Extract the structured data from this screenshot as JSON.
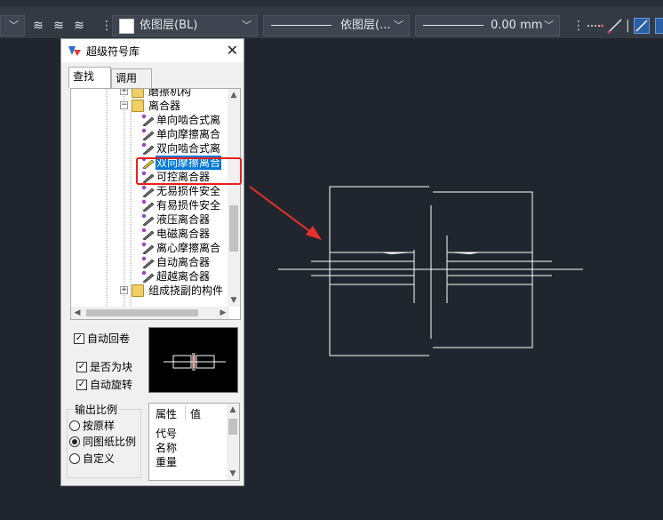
{
  "toolbar": {
    "layer_name": "依图层(BL)",
    "linetype_label": "依图层(...",
    "lineweight_label": "0.00 mm"
  },
  "dialog": {
    "title": "超级符号库",
    "close_glyph": "✕",
    "tabs": [
      {
        "label": "查找"
      },
      {
        "label": "调用"
      }
    ],
    "tree": [
      {
        "label": "磨擦机构",
        "kind": "folder",
        "expander": "+"
      },
      {
        "label": "离合器",
        "kind": "folder",
        "expander": "−"
      },
      {
        "label": "单向啮合式离",
        "kind": "item"
      },
      {
        "label": "单向摩擦离合",
        "kind": "item"
      },
      {
        "label": "双向啮合式离",
        "kind": "item"
      },
      {
        "label": "双向摩擦离合",
        "kind": "item",
        "selected": true
      },
      {
        "label": "可控离合器",
        "kind": "item"
      },
      {
        "label": "无易损件安全",
        "kind": "item"
      },
      {
        "label": "有易损件安全",
        "kind": "item"
      },
      {
        "label": "液压离合器",
        "kind": "item"
      },
      {
        "label": "电磁离合器",
        "kind": "item"
      },
      {
        "label": "离心摩擦离合",
        "kind": "item"
      },
      {
        "label": "自动离合器",
        "kind": "item"
      },
      {
        "label": "超越离合器",
        "kind": "item"
      },
      {
        "label": "组成挠副的构件",
        "kind": "folder",
        "expander": "+"
      }
    ],
    "auto_return": {
      "label": "自动回卷",
      "checked": true
    },
    "as_block": {
      "label": "是否为块",
      "checked": true
    },
    "auto_rotate": {
      "label": "自动旋转",
      "checked": true
    },
    "scale_group": {
      "title": "输出比例",
      "options": [
        {
          "label": "按原样",
          "selected": false
        },
        {
          "label": "同图纸比例",
          "selected": true
        },
        {
          "label": "自定义",
          "selected": false
        }
      ]
    },
    "props": {
      "col_property": "属性",
      "col_value": "值",
      "rows": [
        "代号",
        "名称",
        "重量"
      ]
    }
  },
  "colors": {
    "background": "#21262e",
    "highlight_box": "#e8201e",
    "arrow": "#e8302a",
    "selection": "#0078d7"
  }
}
